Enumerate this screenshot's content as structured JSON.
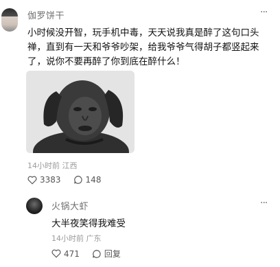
{
  "post": {
    "author": "伽罗饼干",
    "more_label": "···",
    "text": "小时候没开智，玩手机中毒，天天说我真是醉了这句口头禅，直到有一天和爷爷吵架，给我爷爷气得胡子都竖起来了，说你不要再醉了你到底在醉什么！",
    "time": "14小时前",
    "location": "江西",
    "likes": "3383",
    "comments": "148",
    "image_icon": "dog-with-human-face-meme"
  },
  "reply": {
    "author": "火锅大虾",
    "more_label": "···",
    "text": "大半夜笑得我难受",
    "time": "14小时前",
    "location": "广东",
    "likes": "471",
    "reply_label": "回复"
  }
}
